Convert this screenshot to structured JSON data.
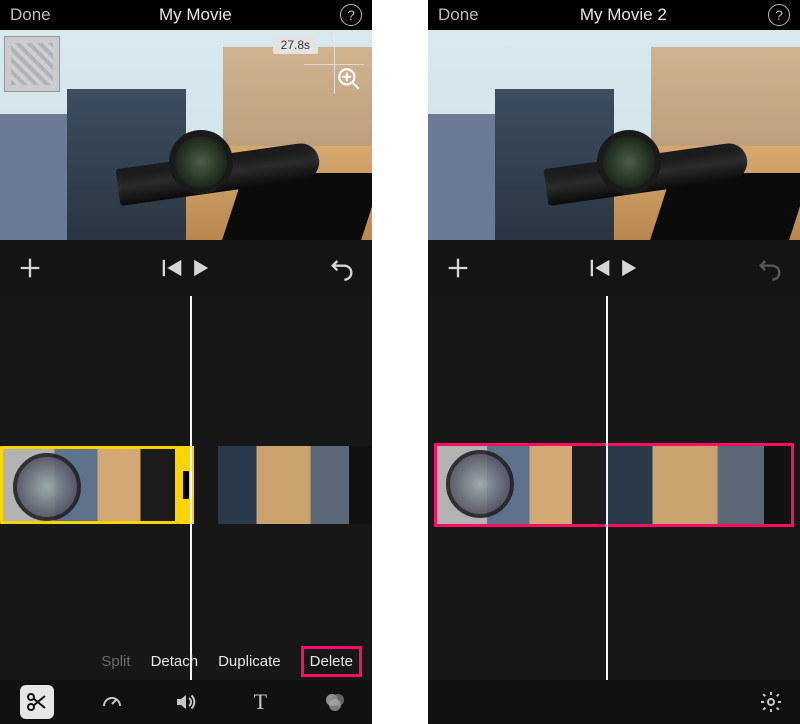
{
  "left": {
    "topbar": {
      "done": "Done",
      "title": "My Movie",
      "help": "?"
    },
    "preview": {
      "time_badge": "27.8s"
    },
    "actions": {
      "split": "Split",
      "detach": "Detach",
      "duplicate": "Duplicate",
      "delete": "Delete"
    },
    "toolbar": {
      "scissors": "scissors-icon",
      "speed": "speedometer-icon",
      "volume": "volume-icon",
      "text": "T",
      "filters": "filters-icon"
    }
  },
  "right": {
    "topbar": {
      "done": "Done",
      "title": "My Movie 2",
      "help": "?"
    },
    "toolbar": {
      "gear": "gear-icon"
    }
  }
}
